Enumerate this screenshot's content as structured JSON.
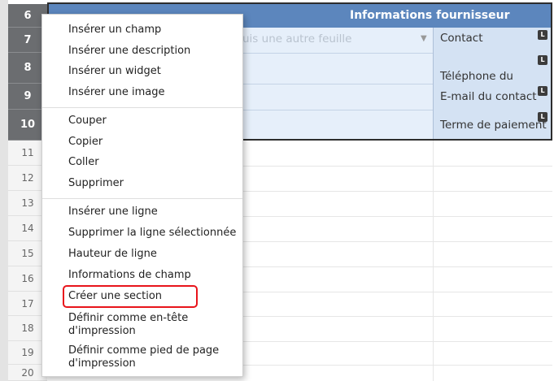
{
  "rows_top": [
    "6",
    "7",
    "8",
    "9",
    "10"
  ],
  "rows_bottom": [
    "11",
    "12",
    "13",
    "14",
    "15",
    "16",
    "17",
    "18",
    "19",
    "20"
  ],
  "header": {
    "title": "Informations fournisseur"
  },
  "faded_text": "uis une autre feuille",
  "side_cells": [
    {
      "label": "Contact",
      "tag": "L"
    },
    {
      "label": "Téléphone du\ncontact",
      "tag": "L"
    },
    {
      "label": "E-mail du contact",
      "tag": "L"
    },
    {
      "label": "Terme de paiement",
      "tag": "L"
    }
  ],
  "menu": {
    "groups": [
      [
        "Insérer un champ",
        "Insérer une description",
        "Insérer un widget",
        "Insérer une image"
      ],
      [
        "Couper",
        "Copier",
        "Coller",
        "Supprimer"
      ],
      [
        "Insérer une ligne",
        "Supprimer la ligne sélectionnée",
        "Hauteur de ligne",
        "Informations de champ",
        "Créer une section",
        "Définir comme en-tête\nd'impression",
        "Définir comme pied de page\nd'impression"
      ]
    ]
  },
  "highlight": {
    "target": "Créer une section",
    "color": "#e8141b"
  },
  "colors": {
    "header_blue": "#5c86bd",
    "light_blue": "#e6effa",
    "side_blue": "#d4e2f3",
    "row_dark": "#6b6d70"
  }
}
